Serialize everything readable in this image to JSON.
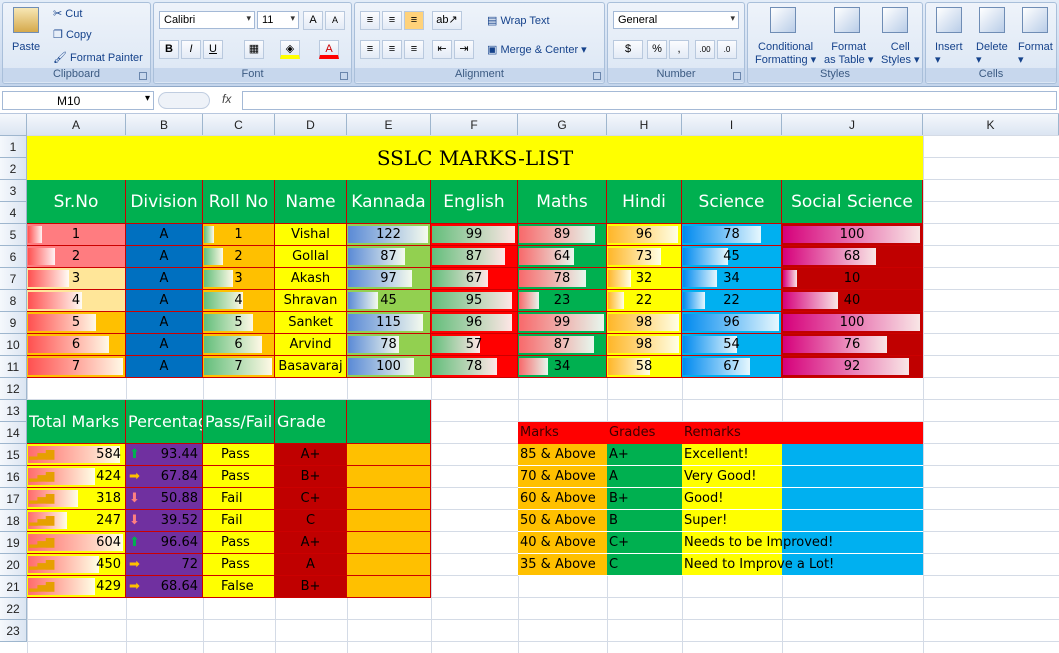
{
  "ribbon": {
    "clipboard": {
      "label": "Clipboard",
      "paste": "Paste",
      "cut": "Cut",
      "copy": "Copy",
      "format_painter": "Format Painter"
    },
    "font": {
      "label": "Font",
      "name": "Calibri",
      "size": "11",
      "bold": "B",
      "italic": "I",
      "underline": "U",
      "grow": "A",
      "shrink": "A",
      "font_color": "A"
    },
    "alignment": {
      "label": "Alignment",
      "wrap": "Wrap Text",
      "merge": "Merge & Center"
    },
    "number": {
      "label": "Number",
      "format": "General",
      "currency": "$",
      "percent": "%",
      "comma": ",",
      "inc_dec": ".00",
      "dec_dec": ".0"
    },
    "styles": {
      "label": "Styles",
      "conditional": "Conditional",
      "conditional2": "Formatting",
      "format_table": "Format",
      "format_table2": "as Table",
      "cell_styles": "Cell",
      "cell_styles2": "Styles"
    },
    "cells": {
      "label": "Cells",
      "insert": "Insert",
      "delete": "Delete",
      "format": "Format"
    }
  },
  "formula_bar": {
    "name_box": "M10",
    "fx": "fx",
    "formula": ""
  },
  "columns": [
    "A",
    "B",
    "C",
    "D",
    "E",
    "F",
    "G",
    "H",
    "I",
    "J",
    "K"
  ],
  "rows": [
    "1",
    "2",
    "3",
    "4",
    "5",
    "6",
    "7",
    "8",
    "9",
    "10",
    "11",
    "12",
    "13",
    "14",
    "15",
    "16",
    "17",
    "18",
    "19",
    "20",
    "21",
    "22",
    "23"
  ],
  "title": "SSLC MARKS-LIST",
  "headers": [
    "Sr.No",
    "Division",
    "Roll No",
    "Name",
    "Kannada",
    "English",
    "Maths",
    "Hindi",
    "Science",
    "Social Science"
  ],
  "students": [
    {
      "sr": "1",
      "div": "A",
      "roll": "1",
      "name": "Vishal",
      "kan": "122",
      "eng": "99",
      "mat": "89",
      "hin": "96",
      "sci": "78",
      "soc": "100"
    },
    {
      "sr": "2",
      "div": "A",
      "roll": "2",
      "name": "Gollal",
      "kan": "87",
      "eng": "87",
      "mat": "64",
      "hin": "73",
      "sci": "45",
      "soc": "68"
    },
    {
      "sr": "3",
      "div": "A",
      "roll": "3",
      "name": "Akash",
      "kan": "97",
      "eng": "67",
      "mat": "78",
      "hin": "32",
      "sci": "34",
      "soc": "10"
    },
    {
      "sr": "4",
      "div": "A",
      "roll": "4",
      "name": "Shravan",
      "kan": "45",
      "eng": "95",
      "mat": "23",
      "hin": "22",
      "sci": "22",
      "soc": "40"
    },
    {
      "sr": "5",
      "div": "A",
      "roll": "5",
      "name": "Sanket",
      "kan": "115",
      "eng": "96",
      "mat": "99",
      "hin": "98",
      "sci": "96",
      "soc": "100"
    },
    {
      "sr": "6",
      "div": "A",
      "roll": "6",
      "name": "Arvind",
      "kan": "78",
      "eng": "57",
      "mat": "87",
      "hin": "98",
      "sci": "54",
      "soc": "76"
    },
    {
      "sr": "7",
      "div": "A",
      "roll": "7",
      "name": "Basavaraj",
      "kan": "100",
      "eng": "78",
      "mat": "34",
      "hin": "58",
      "sci": "67",
      "soc": "92"
    }
  ],
  "summary_headers": [
    "Total Marks",
    "Percentage",
    "Pass/Fail",
    "Grade"
  ],
  "summary": [
    {
      "total": "584",
      "pct": "93.44",
      "arrow": "up",
      "result": "Pass",
      "grade": "A+"
    },
    {
      "total": "424",
      "pct": "67.84",
      "arrow": "right",
      "result": "Pass",
      "grade": "B+"
    },
    {
      "total": "318",
      "pct": "50.88",
      "arrow": "down",
      "result": "Fail",
      "grade": "C+"
    },
    {
      "total": "247",
      "pct": "39.52",
      "arrow": "down",
      "result": "Fail",
      "grade": "C"
    },
    {
      "total": "604",
      "pct": "96.64",
      "arrow": "up",
      "result": "Pass",
      "grade": "A+"
    },
    {
      "total": "450",
      "pct": "72",
      "arrow": "right",
      "result": "Pass",
      "grade": "A"
    },
    {
      "total": "429",
      "pct": "68.64",
      "arrow": "right",
      "result": "False",
      "grade": "B+"
    }
  ],
  "grades_table": {
    "headers": [
      "Marks",
      "Grades",
      "Remarks"
    ],
    "rows": [
      {
        "marks": "85 & Above",
        "grade": "A+",
        "remark": "Excellent!"
      },
      {
        "marks": "70 & Above",
        "grade": "A",
        "remark": "Very Good!"
      },
      {
        "marks": "60 & Above",
        "grade": "B+",
        "remark": "Good!"
      },
      {
        "marks": "50 & Above",
        "grade": "B",
        "remark": "Super!"
      },
      {
        "marks": "40 & Above",
        "grade": "C+",
        "remark": "Needs to be Improved!"
      },
      {
        "marks": "35 &  Above",
        "grade": "C",
        "remark": "Need to Improve a Lot!"
      }
    ]
  },
  "colors": {
    "title_bg": "#ffff00",
    "header_bg": "#00b050",
    "division": "#0070c0",
    "orange": "#ffc000",
    "red": "#ff0000",
    "purple": "#7030a0",
    "darkred": "#c00000",
    "yellow": "#ffff00",
    "blue": "#00b0f0",
    "green": "#00b050"
  }
}
